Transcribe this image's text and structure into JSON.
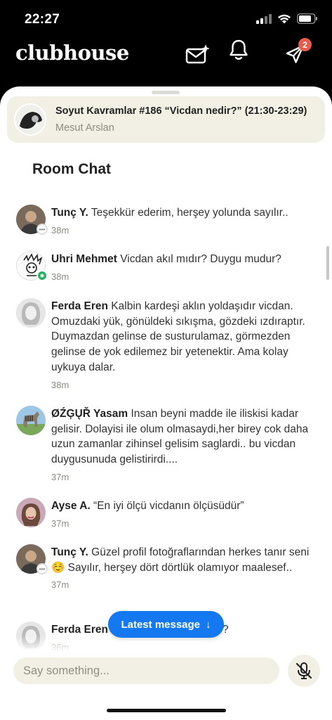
{
  "status_bar": {
    "time": "22:27"
  },
  "header": {
    "logo": "clubhouse",
    "notifications_badge": "2",
    "icons": [
      "new-message-icon",
      "bell-icon",
      "paper-plane-icon"
    ]
  },
  "room": {
    "title": "Soyut Kavramlar #186 “Vicdan nedir?” (21:30-23:29)",
    "host": "Mesut Arslan"
  },
  "chat": {
    "heading": "Room Chat",
    "latest_label": "Latest message",
    "latest_arrow": "↓",
    "messages": [
      {
        "name": "Tunç Y.",
        "text": "Teşekkür ederim, herşey yolunda sayılır..",
        "time": "38m",
        "badge": "chat"
      },
      {
        "name": "Uhri Mehmet",
        "text": "Vicdan akıl mıdır? Duygu mudur?",
        "time": "38m",
        "badge": "new"
      },
      {
        "name": "Ferda Eren",
        "text": "Kalbin kardeşi aklın yoldaşıdır vicdan. Omuzdaki yük, gönüldeki sıkışma, gözdeki ızdıraptır. Duymazdan gelinse de susturulamaz, görmezden gelinse de yok edilemez bir yetenektir. Ama kolay uykuya dalar.",
        "time": "38m",
        "badge": ""
      },
      {
        "name": "ØŹĢŲŘ Yasam",
        "text": "Insan beyni madde ile iliskisi kadar gelisir. Dolayisi ile olum olmasaydi,her birey cok daha uzun zamanlar zihinsel gelisim saglardi.. bu vicdan duygusunuda gelistirirdi....",
        "time": "37m",
        "badge": ""
      },
      {
        "name": "Ayse A.",
        "text": "“En iyi ölçü vicdanın ölçüsüdür”",
        "time": "37m",
        "badge": ""
      },
      {
        "name": "Tunç Y.",
        "text": "Güzel profil fotoğraflarından herkes tanır seni ☺️ Sayılır, herşey dört dörtlük olamıyor maalesef..",
        "time": "37m",
        "badge": "chat"
      },
      {
        "name": "Ferda Eren",
        "text": "?",
        "time": "36m",
        "badge": ""
      }
    ]
  },
  "composer": {
    "placeholder": "Say something..."
  },
  "colors": {
    "accent": "#1478f0",
    "card": "#f2f0e4",
    "badge": "#e95b4a",
    "new_badge": "#27ae60"
  }
}
